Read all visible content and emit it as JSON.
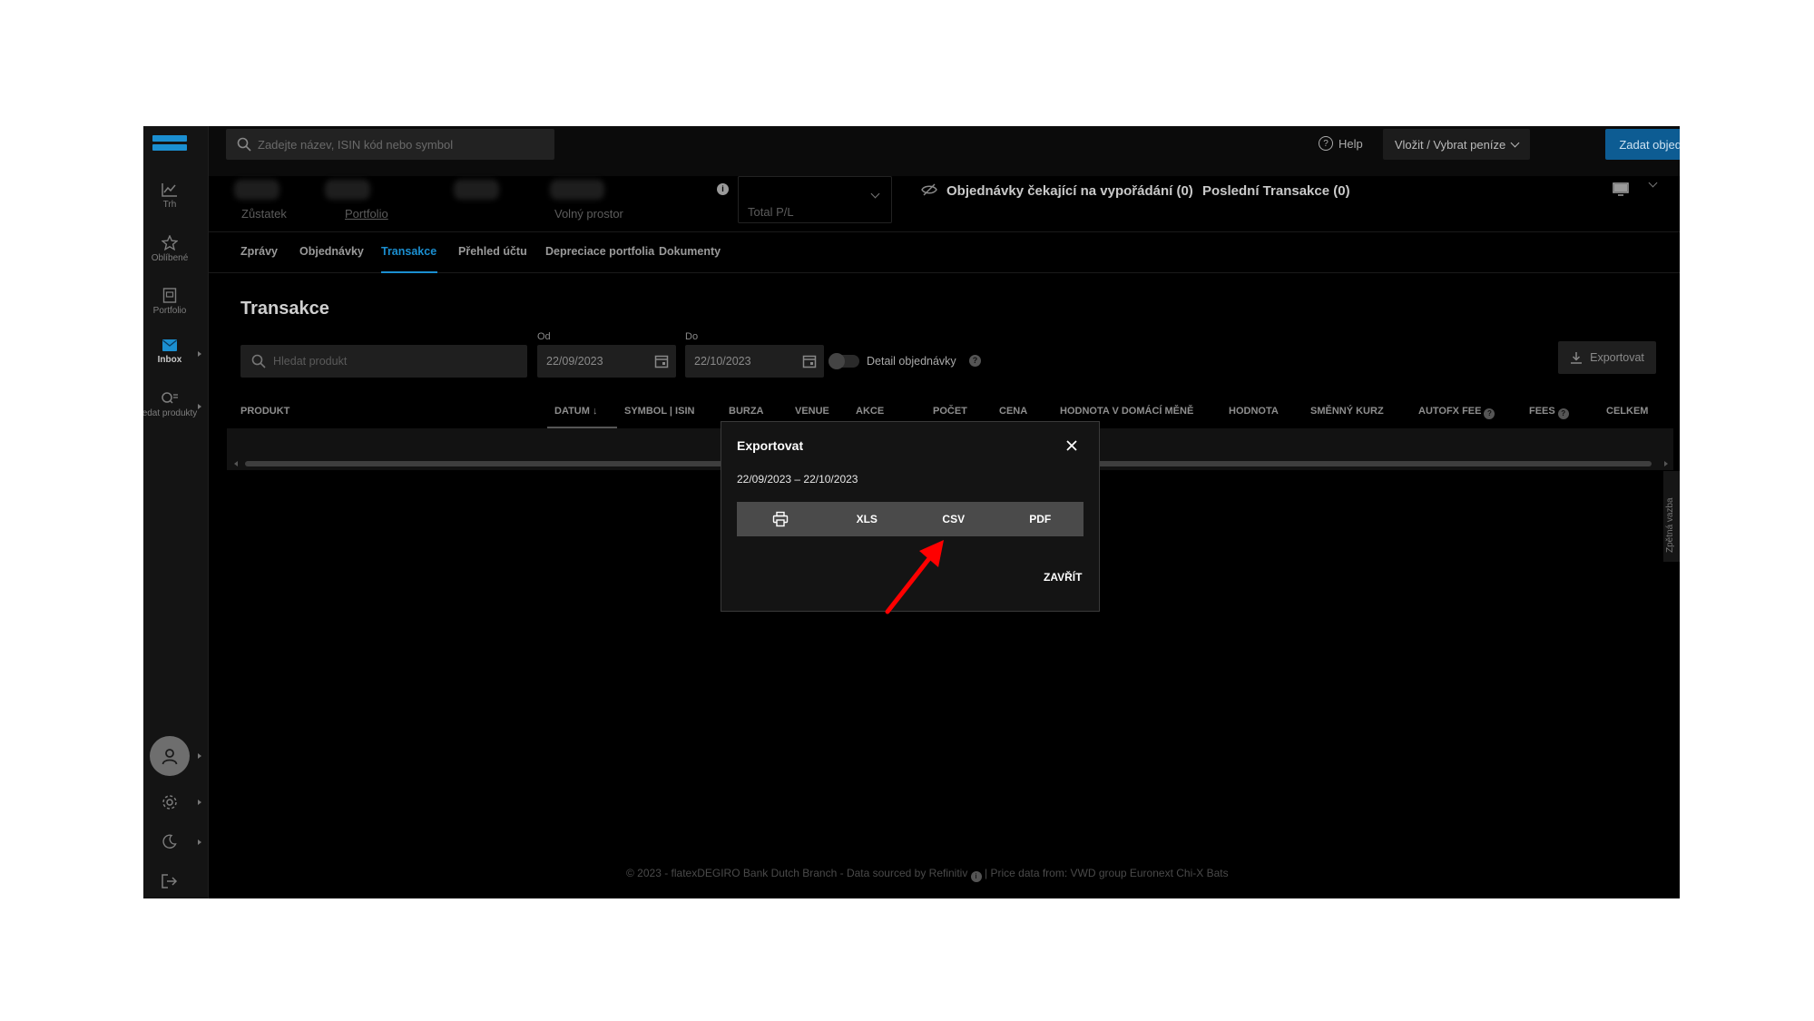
{
  "topbar": {
    "search_placeholder": "Zadejte název, ISIN kód nebo symbol",
    "help_label": "Help",
    "deposit_label": "Vložit / Vybrat peníze",
    "order_label": "Zadat objednávku"
  },
  "sidebar": {
    "items": [
      {
        "label": "Trh",
        "icon": "chart-line-icon"
      },
      {
        "label": "Oblíbené",
        "icon": "star-icon"
      },
      {
        "label": "Portfolio",
        "icon": "portfolio-icon"
      },
      {
        "label": "Inbox",
        "icon": "mail-icon"
      },
      {
        "label": "edat produkty",
        "icon": "search-products-icon"
      }
    ]
  },
  "account": {
    "balance_label": "Zůstatek",
    "portfolio_label": "Portfolio",
    "free_space_label": "Volný prostor",
    "pl_label": "Total P/L",
    "pending_orders": "Objednávky čekající na vypořádání (0)",
    "last_transactions": "Poslední Transakce (0)"
  },
  "tabs": [
    {
      "label": "Zprávy"
    },
    {
      "label": "Objednávky"
    },
    {
      "label": "Transakce"
    },
    {
      "label": "Přehled účtu"
    },
    {
      "label": "Depreciace portfolia"
    },
    {
      "label": "Dokumenty"
    }
  ],
  "main": {
    "title": "Transakce",
    "product_search_placeholder": "Hledat produkt",
    "from_label": "Od",
    "from_value": "22/09/2023",
    "to_label": "Do",
    "to_value": "22/10/2023",
    "detail_label": "Detail objednávky",
    "export_label": "Exportovat",
    "columns": [
      "PRODUKT",
      "DATUM ↓",
      "SYMBOL | ISIN",
      "BURZA",
      "VENUE",
      "AKCE",
      "POČET",
      "CENA",
      "HODNOTA V DOMÁCÍ MĚNĚ",
      "HODNOTA",
      "SMĚNNÝ KURZ",
      "AUTOFX FEE",
      "FEES",
      "CELKEM"
    ],
    "feedback_label": "Zpětná vazba"
  },
  "modal": {
    "title": "Exportovat",
    "range": "22/09/2023 – 22/10/2023",
    "formats": [
      "XLS",
      "CSV",
      "PDF"
    ],
    "close_label": "ZAVŘÍT"
  },
  "footer": {
    "text_a": "© 2023 - flatexDEGIRO Bank Dutch Branch - Data sourced by Refinitiv",
    "text_b": "| Price data from: VWD group Euronext Chi-X Bats"
  },
  "colors": {
    "accent": "#1b8fd1",
    "annotation_arrow": "#ff0000"
  }
}
